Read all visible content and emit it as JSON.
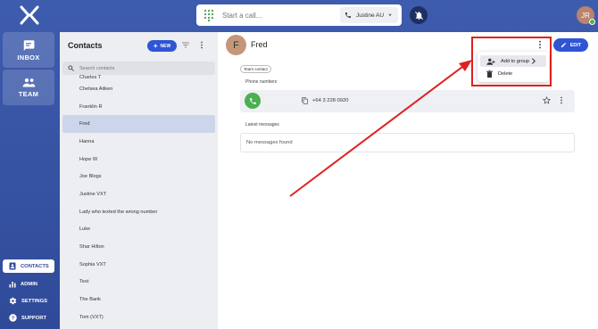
{
  "topbar": {
    "call_placeholder": "Start a call...",
    "line_select": "Justine AU",
    "user_initials": "JR"
  },
  "nav": {
    "inbox": "INBOX",
    "team": "TEAM",
    "contacts": "CONTACTS",
    "admin": "ADMIN",
    "settings": "SETTINGS",
    "support": "SUPPORT"
  },
  "contacts": {
    "title": "Contacts",
    "new_label": "NEW",
    "search_placeholder": "Search contacts",
    "items": [
      "Charles T",
      "Chelsea Aitken",
      "Franklin R",
      "Fred",
      "Hanna",
      "Hope W",
      "Joe Blogs",
      "Justine VXT",
      "Lady who texted the wrong number",
      "Luke",
      "Shar Hilton",
      "Sophia VXT",
      "Test",
      "The Bank",
      "Tom (VXT)"
    ],
    "selected": "Fred"
  },
  "detail": {
    "avatar_initial": "F",
    "name": "Fred",
    "edit_label": "EDIT",
    "badge": "Team contact",
    "phone_section": "Phone numbers",
    "phone_number": "+64 3 228 0920",
    "messages_section": "Latest messages",
    "no_messages": "No messages found"
  },
  "menu": {
    "add_to_group": "Add to group",
    "delete": "Delete"
  },
  "colors": {
    "sidebar": "#3a57a8",
    "primary_button": "#2f55d4",
    "call_green": "#4caf50",
    "annotation_red": "#e02020"
  }
}
